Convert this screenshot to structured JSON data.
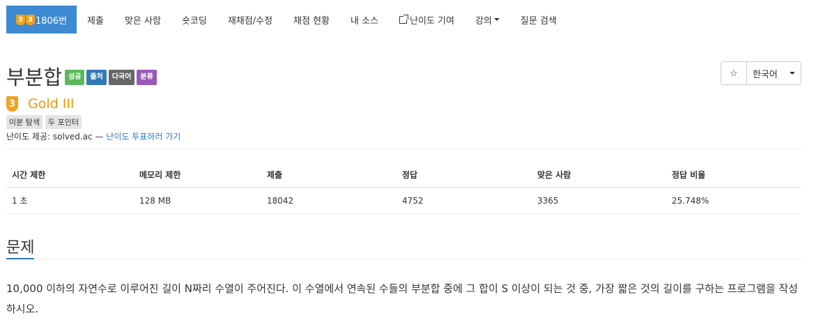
{
  "nav": {
    "problem_number": "1806번",
    "tier_badges": [
      "3",
      "3"
    ],
    "items": [
      "제출",
      "맞은 사람",
      "숏코딩",
      "재채점/수정",
      "채점 현황",
      "내 소스",
      "난이도 기여",
      "강의",
      "질문 검색"
    ]
  },
  "problem": {
    "title": "부분합",
    "labels": [
      {
        "text": "성공",
        "color": "#5cb85c"
      },
      {
        "text": "출처",
        "color": "#337ab7"
      },
      {
        "text": "다국어",
        "color": "#666666"
      },
      {
        "text": "분류",
        "color": "#9b59b6"
      }
    ],
    "tier_number": "3",
    "tier_text": "Gold III",
    "tags": [
      "이분 탐색",
      "두 포인터"
    ],
    "provider_prefix": "난이도 제공: solved.ac — ",
    "provider_link": "난이도 투표하러 가기"
  },
  "controls": {
    "star": "☆",
    "language": "한국어"
  },
  "stats": {
    "headers": [
      "시간 제한",
      "메모리 제한",
      "제출",
      "정답",
      "맞은 사람",
      "정답 비율"
    ],
    "values": [
      "1 초",
      "128 MB",
      "18042",
      "4752",
      "3365",
      "25.748%"
    ]
  },
  "section": {
    "title": "문제",
    "text": "10,000 이하의 자연수로 이루어진 길이 N짜리 수열이 주어진다. 이 수열에서 연속된 수들의 부분합 중에 그 합이 S 이상이 되는 것 중, 가장 짧은 것의 길이를 구하는 프로그램을 작성하시오."
  },
  "colors": {
    "accent": "#3d89d2",
    "gold": "#ec9a00",
    "link": "#2a7ac7"
  }
}
